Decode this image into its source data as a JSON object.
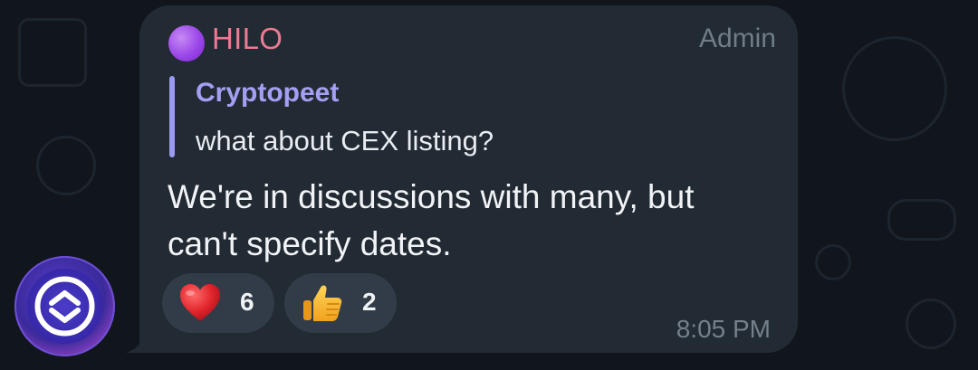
{
  "message": {
    "sender": {
      "name": "HILO",
      "badge_icon": "purple-circle-icon",
      "role": "Admin",
      "name_color": "#ec7a91"
    },
    "reply": {
      "author": "Cryptopeet",
      "text": "what about CEX listing?"
    },
    "text_line1": "We're in discussions with many, but",
    "text_line2": "can't specify dates.",
    "reactions": [
      {
        "icon": "red-heart-icon",
        "count": "6"
      },
      {
        "icon": "thumbs-up-icon",
        "count": "2"
      }
    ],
    "time": "8:05 PM"
  },
  "avatar": {
    "icon": "hilo-logo-icon"
  },
  "colors": {
    "bubble": "#222a33",
    "reply_accent": "#9b9af0",
    "reaction_bg": "#323c48"
  }
}
